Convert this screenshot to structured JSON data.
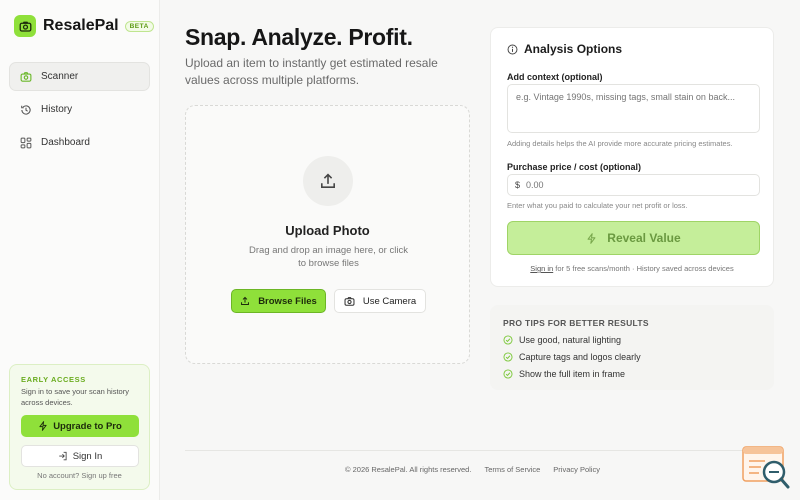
{
  "brand": {
    "name": "ResalePal",
    "badge": "BETA"
  },
  "nav": [
    {
      "label": "Scanner",
      "icon": "camera-icon",
      "active": true
    },
    {
      "label": "History",
      "icon": "history-icon",
      "active": false
    },
    {
      "label": "Dashboard",
      "icon": "dashboard-icon",
      "active": false
    }
  ],
  "promo": {
    "label": "EARLY ACCESS",
    "text": "Sign in to save your scan history across devices.",
    "upgrade_label": "Upgrade to Pro",
    "signin_label": "Sign In",
    "footer": "No account? Sign up free"
  },
  "hero": {
    "title": "Snap. Analyze. Profit.",
    "subtitle": "Upload an item to instantly get estimated resale values across multiple platforms."
  },
  "upload": {
    "title": "Upload Photo",
    "description": "Drag and drop an image here, or click to browse files",
    "browse_label": "Browse Files",
    "camera_label": "Use Camera"
  },
  "options": {
    "title": "Analysis Options",
    "context_label": "Add context (optional)",
    "context_placeholder": "e.g. Vintage 1990s, missing tags, small stain on back...",
    "context_hint": "Adding details helps the AI provide more accurate pricing estimates.",
    "price_label": "Purchase price / cost (optional)",
    "currency": "$",
    "price_placeholder": "0.00",
    "price_hint": "Enter what you paid to calculate your net profit or loss.",
    "reveal_label": "Reveal Value",
    "signin_link": "Sign in",
    "signin_note": " for 5 free scans/month · History saved across devices"
  },
  "tips": {
    "title": "PRO TIPS FOR BETTER RESULTS",
    "items": [
      "Use good, natural lighting",
      "Capture tags and logos clearly",
      "Show the full item in frame"
    ]
  },
  "footer": {
    "copyright": "© 2026 ResalePal. All rights reserved.",
    "terms": "Terms of Service",
    "privacy": "Privacy Policy"
  },
  "colors": {
    "accent": "#8fe03a",
    "accent_muted": "#c5ee9a"
  }
}
